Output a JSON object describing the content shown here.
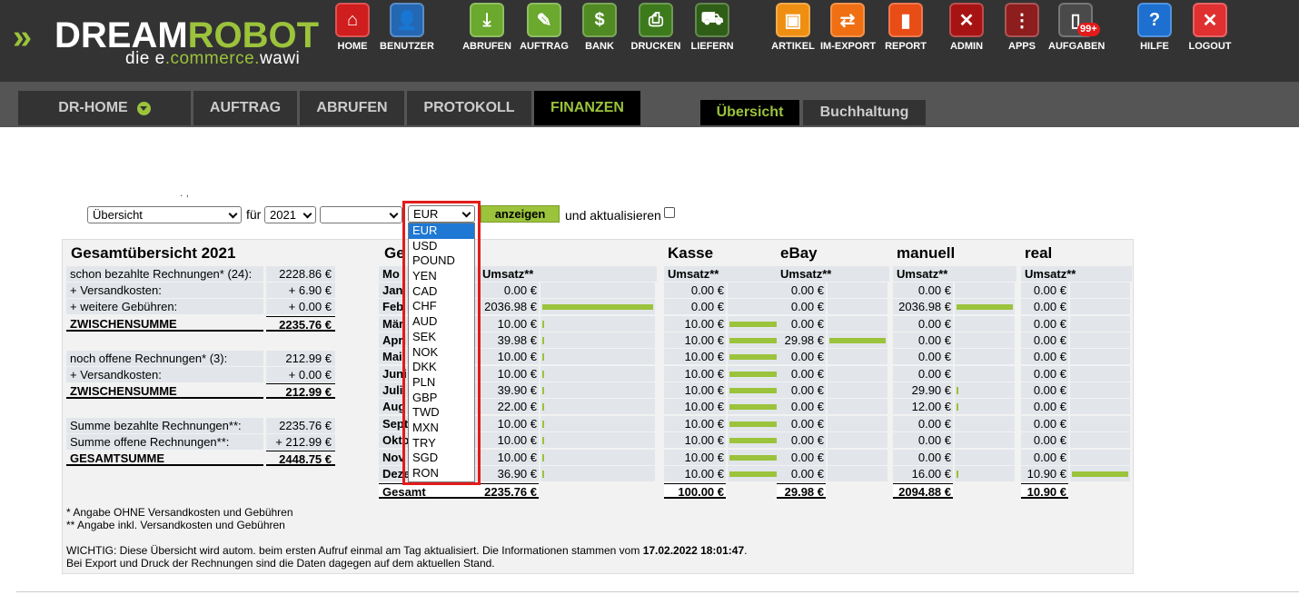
{
  "brand": {
    "part1": "DREAM",
    "part2": "ROBOT",
    "tag1": "die e",
    "tag2": ".commerce.",
    "tag3": "wawi"
  },
  "nav": [
    {
      "label": "HOME",
      "color": "#d01d1d",
      "icon": "home-icon",
      "glyph": "⌂"
    },
    {
      "label": "BENUTZER",
      "color": "#2467b3",
      "icon": "user-icon",
      "glyph": "👤"
    },
    {
      "label": "ABRUFEN",
      "color": "#6aa82e",
      "icon": "download-icon",
      "glyph": "⤓"
    },
    {
      "label": "AUFTRAG",
      "color": "#6aa82e",
      "icon": "order-icon",
      "glyph": "✎"
    },
    {
      "label": "BANK",
      "color": "#4f8a22",
      "icon": "bank-icon",
      "glyph": "$"
    },
    {
      "label": "DRUCKEN",
      "color": "#3d7a1c",
      "icon": "print-icon",
      "glyph": "⎙"
    },
    {
      "label": "LIEFERN",
      "color": "#2f5f16",
      "icon": "cart-icon",
      "glyph": "⛟"
    },
    {
      "label": "ARTIKEL",
      "color": "#ef8f12",
      "icon": "box-icon",
      "glyph": "▣"
    },
    {
      "label": "IM-EXPORT",
      "color": "#ef6f12",
      "icon": "import-export-icon",
      "glyph": "⇄"
    },
    {
      "label": "REPORT",
      "color": "#e84d16",
      "icon": "report-icon",
      "glyph": "▮"
    },
    {
      "label": "ADMIN",
      "color": "#a71313",
      "icon": "admin-icon",
      "glyph": "✕"
    },
    {
      "label": "APPS",
      "color": "#8e1d1d",
      "icon": "apps-icon",
      "glyph": "⋮"
    },
    {
      "label": "AUFGABEN",
      "color": "#4a4a4a",
      "icon": "tasks-icon",
      "glyph": "▯",
      "badge": "99+"
    },
    {
      "label": "HILFE",
      "color": "#1d6fd0",
      "icon": "help-icon",
      "glyph": "?"
    },
    {
      "label": "LOGOUT",
      "color": "#e03030",
      "icon": "logout-icon",
      "glyph": "✕"
    }
  ],
  "tabs": {
    "home": "DR-HOME",
    "auftrag": "AUFTRAG",
    "abrufen": "ABRUFEN",
    "protokoll": "PROTOKOLL",
    "finanzen": "FINANZEN"
  },
  "subtabs": {
    "uebersicht": "Übersicht",
    "buchhaltung": "Buchhaltung"
  },
  "filter": {
    "view": "Übersicht",
    "fuer": "für",
    "year": "2021",
    "month": "",
    "currency": "EUR",
    "button": "anzeigen",
    "update": "und aktualisieren",
    "stray": ". ,"
  },
  "currencies": [
    "EUR",
    "USD",
    "POUND",
    "YEN",
    "CAD",
    "CHF",
    "AUD",
    "SEK",
    "NOK",
    "DKK",
    "PLN",
    "GBP",
    "TWD",
    "MXN",
    "TRY",
    "SGD",
    "RON"
  ],
  "summary": {
    "title": "Gesamtübersicht 2021",
    "rows": [
      {
        "label": "schon bezahlte Rechnungen* (24):",
        "value": "2228.86 €"
      },
      {
        "label": "+ Versandkosten:",
        "value": "+ 6.90 €"
      },
      {
        "label": "+ weitere Gebühren:",
        "value": "+ 0.00 €"
      },
      {
        "label": "ZWISCHENSUMME",
        "value": "2235.76 €",
        "bold": true
      },
      {
        "label": "noch offene Rechnungen* (3):",
        "value": "212.99 €"
      },
      {
        "label": "+ Versandkosten:",
        "value": "+ 0.00 €"
      },
      {
        "label": "ZWISCHENSUMME",
        "value": "212.99 €",
        "bold": true
      },
      {
        "label": "Summe bezahlte Rechnungen**:",
        "value": "2235.76 €"
      },
      {
        "label": "Summe offene Rechnungen**:",
        "value": "+ 212.99 €"
      },
      {
        "label": "GESAMTSUMME",
        "value": "2448.75 €",
        "bold": true
      }
    ]
  },
  "monthly": {
    "title_visible": "Ge",
    "col_header_visible": "Mo",
    "months_visible": [
      "Jan",
      "Feb",
      "Mär",
      "Apri",
      "Mai",
      "Juni",
      "Juli",
      "Aug",
      "Sept",
      "Okto",
      "Nov",
      "Deze"
    ],
    "total_label": "Gesamt",
    "umsatz_label": "Umsatz**",
    "channels": [
      {
        "name": "",
        "values": [
          "0.00 €",
          "2036.98 €",
          "10.00 €",
          "39.98 €",
          "10.00 €",
          "10.00 €",
          "39.90 €",
          "22.00 €",
          "10.00 €",
          "10.00 €",
          "10.00 €",
          "36.90 €"
        ],
        "bar": [
          0,
          1,
          0.005,
          0.02,
          0.005,
          0.005,
          0.02,
          0.011,
          0.005,
          0.005,
          0.005,
          0.018
        ],
        "total": "2235.76 €"
      },
      {
        "name": "Kasse",
        "values": [
          "0.00 €",
          "0.00 €",
          "10.00 €",
          "10.00 €",
          "10.00 €",
          "10.00 €",
          "10.00 €",
          "10.00 €",
          "10.00 €",
          "10.00 €",
          "10.00 €",
          "10.00 €"
        ],
        "bar": [
          0,
          0,
          1,
          1,
          1,
          1,
          1,
          1,
          1,
          1,
          1,
          1
        ],
        "total": "100.00 €"
      },
      {
        "name": "eBay",
        "values": [
          "0.00 €",
          "0.00 €",
          "0.00 €",
          "29.98 €",
          "0.00 €",
          "0.00 €",
          "0.00 €",
          "0.00 €",
          "0.00 €",
          "0.00 €",
          "0.00 €",
          "0.00 €"
        ],
        "bar": [
          0,
          0,
          0,
          1,
          0,
          0,
          0,
          0,
          0,
          0,
          0,
          0
        ],
        "total": "29.98 €"
      },
      {
        "name": "manuell",
        "values": [
          "0.00 €",
          "2036.98 €",
          "0.00 €",
          "0.00 €",
          "0.00 €",
          "0.00 €",
          "29.90 €",
          "12.00 €",
          "0.00 €",
          "0.00 €",
          "0.00 €",
          "16.00 €"
        ],
        "bar": [
          0,
          1,
          0,
          0,
          0,
          0,
          0.015,
          0.006,
          0,
          0,
          0,
          0.008
        ],
        "total": "2094.88 €"
      },
      {
        "name": "real",
        "values": [
          "0.00 €",
          "0.00 €",
          "0.00 €",
          "0.00 €",
          "0.00 €",
          "0.00 €",
          "0.00 €",
          "0.00 €",
          "0.00 €",
          "0.00 €",
          "0.00 €",
          "10.90 €"
        ],
        "bar": [
          0,
          0,
          0,
          0,
          0,
          0,
          0,
          0,
          0,
          0,
          0,
          1
        ],
        "total": "10.90 €"
      }
    ]
  },
  "footnotes": {
    "f1": "* Angabe OHNE Versandkosten und Gebühren",
    "f2": "** Angabe inkl. Versandkosten und Gebühren",
    "f3a": "WICHTIG: Diese Übersicht wird autom. beim ersten Aufruf einmal am Tag aktualisiert. Die Informationen stammen vom ",
    "f3b": "17.02.2022 18:01:47",
    "f3c": ".",
    "f4": "Bei Export und Druck der Rechnungen sind die Daten dagegen auf dem aktuellen Stand."
  }
}
